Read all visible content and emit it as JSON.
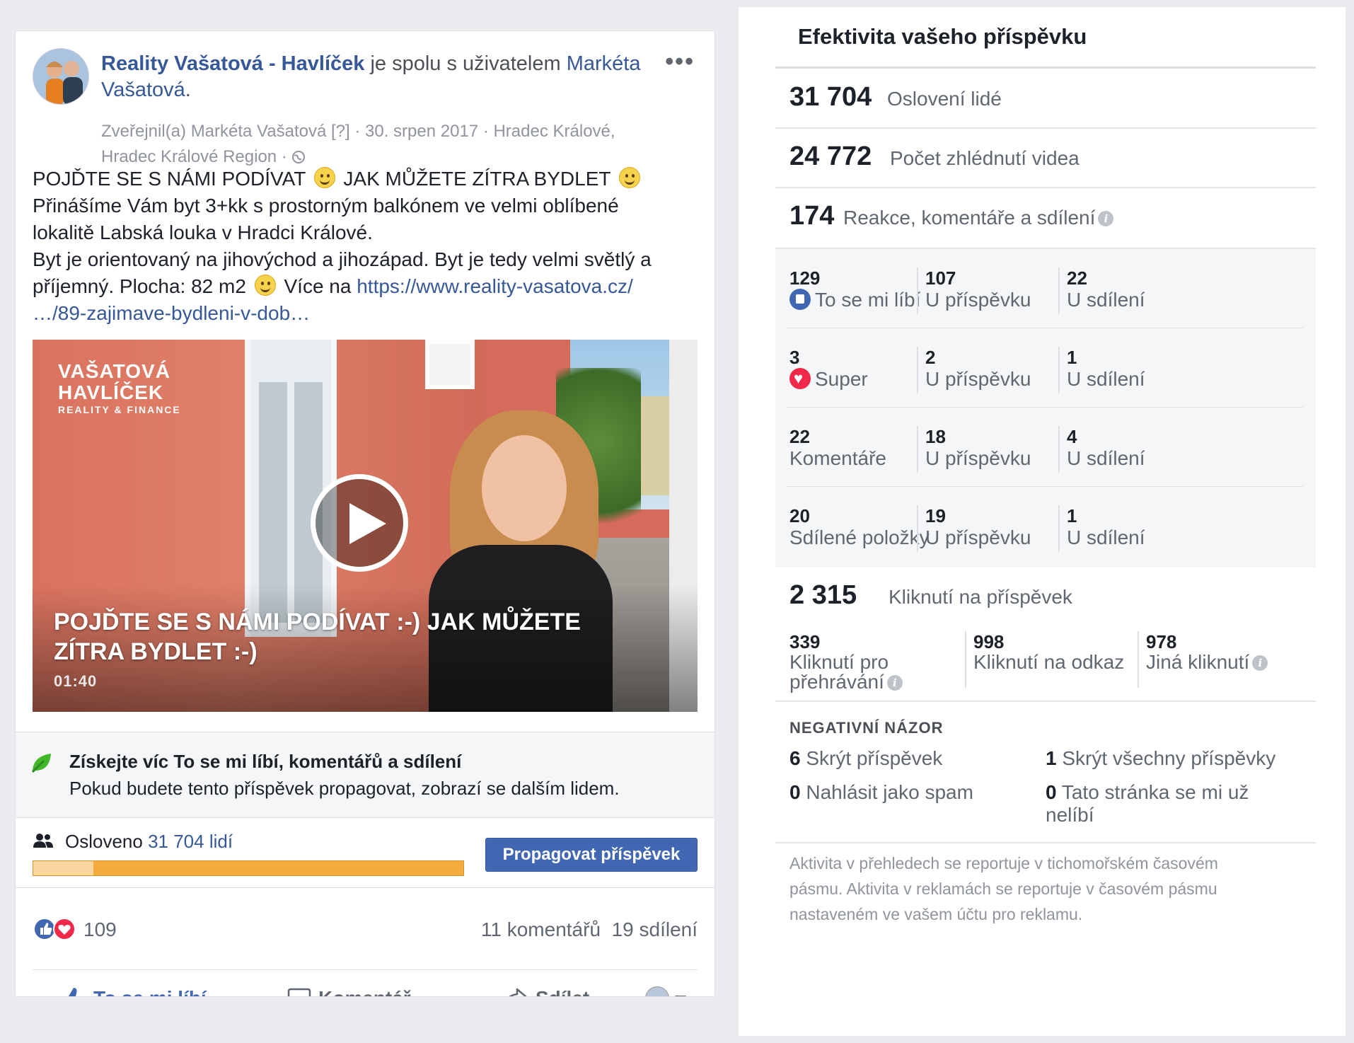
{
  "post": {
    "page_name": "Reality Vašatová - Havlíček",
    "with_text": " je spolu s uživatelem ",
    "with_user": "Markéta Vašatová",
    "title_end": ".",
    "meta_line1": "Zveřejnil(a) Markéta Vašatová [?] · 30. srpen 2017 · Hradec Králové,",
    "meta_line2": "Hradec Králové Region · ",
    "more_icon": "more-dots-icon",
    "body": {
      "l1a": "POJĎTE SE S NÁMI PODÍVAT",
      "l1b": "JAK MŮŽETE ZÍTRA BYDLET",
      "l2": "Přinášíme Vám byt 3+kk s prostorným balkónem ve velmi oblíbené",
      "l3": "lokalitě Labská louka v Hradci Králové.",
      "l4": "Byt je orientovaný na jihovýchod a jihozápad. Byt je tedy velmi světlý a",
      "l5a": "příjemný. Plocha: 82 m2",
      "l5b": " Více na ",
      "link1": "https://www.reality-vasatova.cz/",
      "link2": "…/89-zajimave-bydleni-v-dob…"
    },
    "video": {
      "brand_1": "VAŠATOVÁ",
      "brand_2": "HAVLÍČEK",
      "brand_3": "REALITY & FINANCE",
      "title_1": "POJĎTE SE S NÁMI PODÍVAT :-) JAK MŮŽETE",
      "title_2": "ZÍTRA BYDLET :-)",
      "duration": "01:40"
    },
    "promo": {
      "title": "Získejte víc To se mi líbí, komentářů a sdílení",
      "subtitle": "Pokud budete tento příspěvek propagovat, zobrazí se dalším lidem."
    },
    "reach": {
      "label": "Osloveno ",
      "value": "31 704 lidí",
      "organic_fraction": 0.14,
      "button": "Propagovat příspěvek"
    },
    "stats": {
      "reactions_count": "109",
      "comments": "11 komentářů",
      "shares": "19 sdílení"
    },
    "actions": {
      "like": "To se mi líbí",
      "comment": "Komentář",
      "share": "Sdílet"
    }
  },
  "insights": {
    "title": "Efektivita vašeho příspěvku",
    "reach_num": "31 704",
    "reach_label": "Oslovení lidé",
    "views_num": "24 772",
    "views_label": "Počet zhlédnutí videa",
    "engage_num": "174",
    "engage_label": "Reakce, komentáře a sdílení",
    "reactions": [
      {
        "n": "129",
        "label": "To se mi líbí",
        "icon": "like",
        "post": "107",
        "post_label": "U příspěvku",
        "share": "22",
        "share_label": "U sdílení"
      },
      {
        "n": "3",
        "label": "Super",
        "icon": "love",
        "post": "2",
        "post_label": "U příspěvku",
        "share": "1",
        "share_label": "U sdílení"
      },
      {
        "n": "22",
        "label": "Komentáře",
        "icon": "",
        "post": "18",
        "post_label": "U příspěvku",
        "share": "4",
        "share_label": "U sdílení"
      },
      {
        "n": "20",
        "label": "Sdílené položky",
        "icon": "",
        "post": "19",
        "post_label": "U příspěvku",
        "share": "1",
        "share_label": "U sdílení"
      }
    ],
    "clicks_num": "2 315",
    "clicks_label": "Kliknutí na příspěvek",
    "clicks": {
      "play_n": "339",
      "play_l1": "Kliknutí pro",
      "play_l2": "přehrávání",
      "link_n": "998",
      "link_l": "Kliknutí na odkaz",
      "other_n": "978",
      "other_l": "Jiná kliknutí"
    },
    "negative": {
      "title": "NEGATIVNÍ NÁZOR",
      "hide_n": "6",
      "hide_l": " Skrýt příspěvek",
      "hideall_n": "1",
      "hideall_l": " Skrýt všechny příspěvky",
      "spam_n": "0",
      "spam_l": " Nahlásit jako spam",
      "unlike_n": "0",
      "unlike_l1": " Tato stránka se mi už",
      "unlike_l2": "nelíbí"
    },
    "footnote": {
      "l1": "Aktivita v přehledech se reportuje v tichomořském časovém",
      "l2": "pásmu. Aktivita v reklamách se reportuje v časovém pásmu",
      "l3": "nastaveném ve vašem účtu pro reklamu."
    },
    "info_icon": "info-icon"
  }
}
